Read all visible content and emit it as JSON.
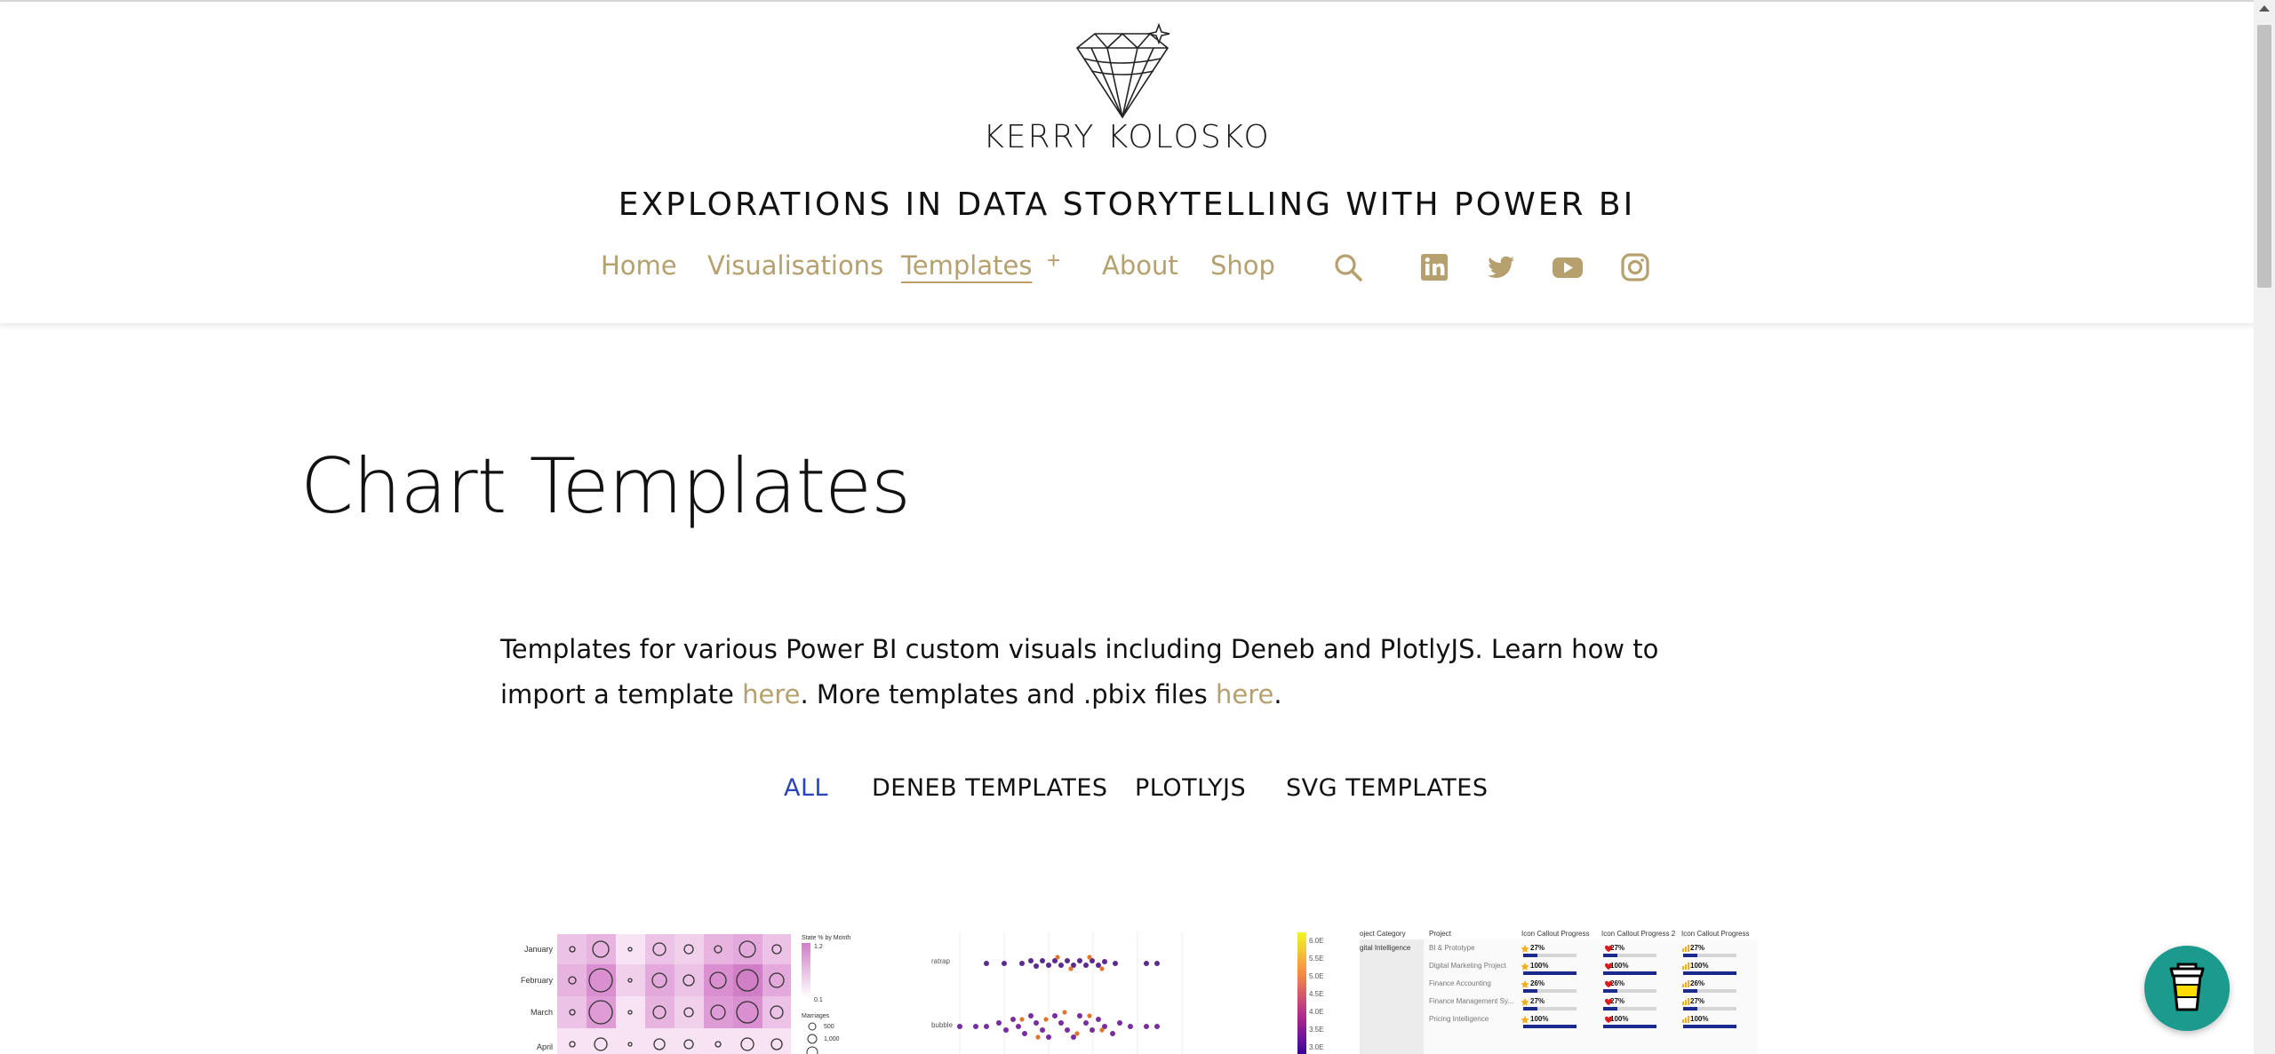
{
  "brand": {
    "logo_icon": "diamond-icon",
    "name": "KERRY KOLOSKO",
    "tagline": "EXPLORATIONS IN DATA STORYTELLING WITH POWER BI"
  },
  "nav": {
    "items": [
      {
        "label": "Home"
      },
      {
        "label": "Visualisations"
      },
      {
        "label": "Templates",
        "active": true
      },
      {
        "label": "About"
      },
      {
        "label": "Shop"
      }
    ],
    "expand_label": "+",
    "icons": [
      "search-icon",
      "linkedin-icon",
      "twitter-icon",
      "youtube-icon",
      "instagram-icon"
    ]
  },
  "page": {
    "title": "Chart Templates",
    "intro_part1": "Templates for various Power BI custom visuals including Deneb and PlotlyJS. Learn how to import a template ",
    "intro_link1": "here",
    "intro_part2": ". More templates and .pbix files ",
    "intro_link2": "here",
    "intro_part3": "."
  },
  "filters": [
    {
      "label": "ALL",
      "active": true
    },
    {
      "label": "DENEB TEMPLATES"
    },
    {
      "label": "PLOTLYJS"
    },
    {
      "label": "SVG TEMPLATES"
    }
  ],
  "thumbnails": {
    "heatmap": {
      "rows": [
        "January",
        "February",
        "March",
        "April"
      ],
      "legend_title": "State % by Month",
      "legend_top": "1.2",
      "legend_bottom": "0.1",
      "size_title": "Marriages",
      "size_values": [
        "500",
        "1,000"
      ]
    },
    "beeswarm": {
      "rows": [
        "ratrap",
        "bubble"
      ],
      "scale_values": [
        "6.0E",
        "5.5E",
        "5.0E",
        "4.5E",
        "4.0E",
        "3.5E",
        "3.0E"
      ]
    },
    "table": {
      "headers": [
        "oject Category",
        "Project",
        "Icon Callout Progress",
        "Icon Callout Progress 2",
        "Icon Callout Progress"
      ],
      "category": "gital Intelligence",
      "rows": [
        {
          "project": "BI & Prototype",
          "v1": "27%",
          "v2": "27%",
          "v3": "27%"
        },
        {
          "project": "Digital Marketing Project",
          "v1": "100%",
          "v2": "100%",
          "v3": "100%"
        },
        {
          "project": "Finance Accounting",
          "v1": "26%",
          "v2": "26%",
          "v3": "26%"
        },
        {
          "project": "Finance Management Sy...",
          "v1": "27%",
          "v2": "27%",
          "v3": "27%"
        },
        {
          "project": "Pricing Intelligence",
          "v1": "100%",
          "v2": "100%",
          "v3": "100%"
        }
      ]
    }
  },
  "colors": {
    "accent_gold": "#b5a06e",
    "filter_active": "#2a43b8",
    "coffee_button": "#1a9b8e"
  },
  "coffee_button_icon": "coffee-cup-icon"
}
